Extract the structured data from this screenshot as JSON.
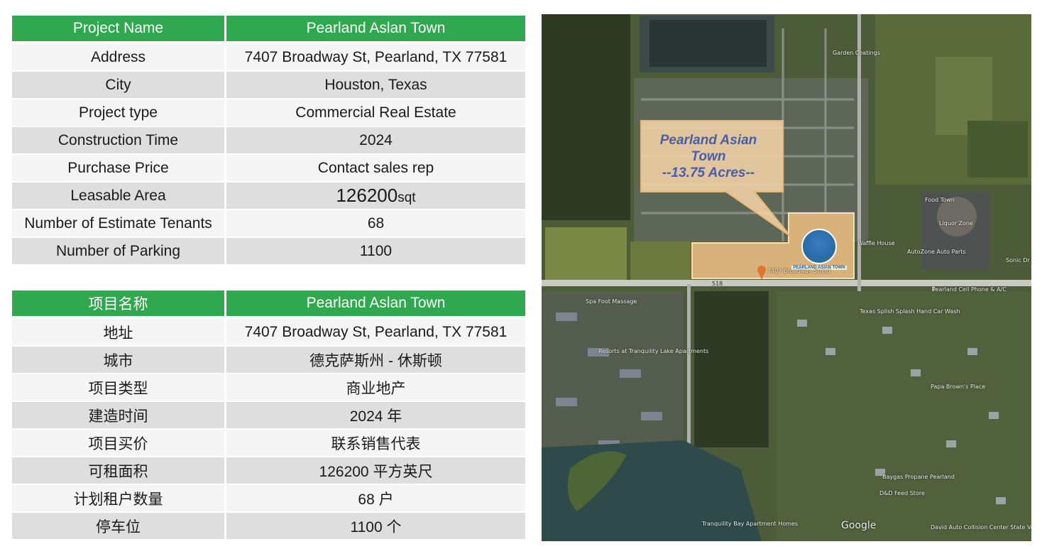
{
  "english_table": {
    "header": {
      "label": "Project Name",
      "value": "Pearland Aslan Town"
    },
    "rows": [
      {
        "label": "Address",
        "value": "7407 Broadway St, Pearland, TX 77581"
      },
      {
        "label": "City",
        "value": "Houston, Texas"
      },
      {
        "label": "Project type",
        "value": "Commercial Real Estate"
      },
      {
        "label": "Construction Time",
        "value": "2024"
      },
      {
        "label": "Purchase Price",
        "value": "Contact sales rep"
      },
      {
        "label": "Leasable Area",
        "value": "126200",
        "unit": "sqt"
      },
      {
        "label": "Number of Estimate Tenants",
        "value": "68"
      },
      {
        "label": "Number of Parking",
        "value": "1100"
      }
    ]
  },
  "chinese_table": {
    "header": {
      "label": "项目名称",
      "value": "Pearland Aslan Town"
    },
    "rows": [
      {
        "label": "地址",
        "value": "7407 Broadway St, Pearland, TX 77581"
      },
      {
        "label": "城市",
        "value": "德克萨斯州 - 休斯顿"
      },
      {
        "label": "项目类型",
        "value": "商业地产"
      },
      {
        "label": "建造时间",
        "value": "2024 年"
      },
      {
        "label": "项目买价",
        "value": "联系销售代表"
      },
      {
        "label": "可租面积",
        "value": "126200 平方英尺"
      },
      {
        "label": "计划租户数量",
        "value": "68 户"
      },
      {
        "label": "停车位",
        "value": "1100 个"
      }
    ]
  },
  "map": {
    "callout": {
      "line1": "Pearland Asian",
      "line2": "Town",
      "line3": "--13.75 Acres--"
    },
    "logo_text": "PEARLAND ASIAN TOWN",
    "street_label": "7407 Broadway Street",
    "road_number": "518",
    "places": [
      "Spa Foot Massage",
      "Texas Splish Splash Hand Car Wash",
      "Food Town",
      "Liquor Zone",
      "AutoZone Auto Parts",
      "Sonic Dr",
      "Waffle House",
      "Resorts at Tranquility Lake Apartments",
      "Tranquility Bay Apartment Homes",
      "Papa Brown's Place",
      "Baygas Propane Pearland",
      "D&D Feed Store",
      "David Auto Collision Center State Vehicle",
      "Garden Coatings",
      "Pearland Cell Phone & A/C"
    ],
    "attribution": "Google",
    "colors": {
      "header_green": "#2fa84f",
      "callout_fill": "#f3d3a6",
      "callout_text": "#4a5da8",
      "site_fill": "#d8b27a"
    }
  }
}
